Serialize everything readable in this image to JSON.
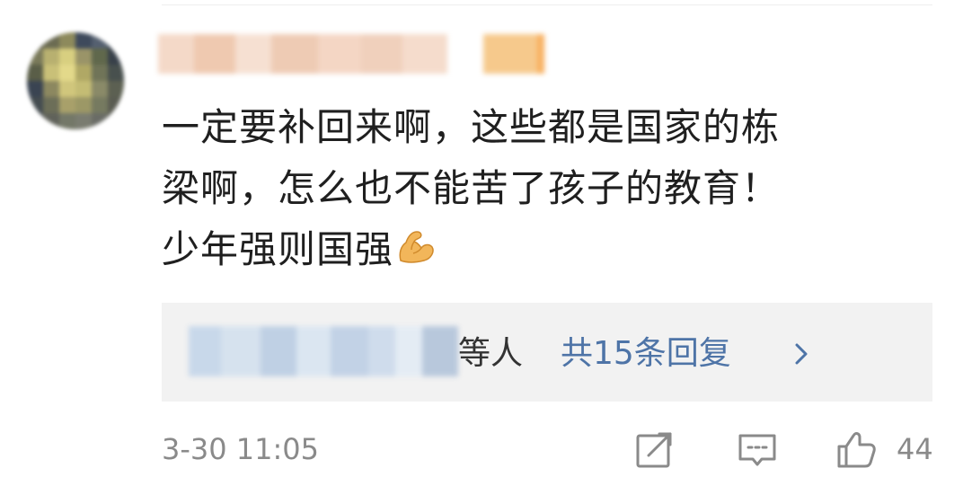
{
  "comment": {
    "line1": "一定要补回来啊，这些都是国家的栋",
    "line2": "梁啊，怎么也不能苦了孩子的教育！",
    "line3": "少年强则国强",
    "emoji": "flexed-biceps-icon"
  },
  "replies": {
    "suffix": "等人",
    "count_label": "共15条回复"
  },
  "footer": {
    "timestamp": "3-30 11:05",
    "like_count": "44"
  },
  "colors": {
    "link_blue": "#4e74a7",
    "meta_gray": "#8a8a8a",
    "reply_bg": "#f2f2f2",
    "text": "#1f1f1f"
  }
}
